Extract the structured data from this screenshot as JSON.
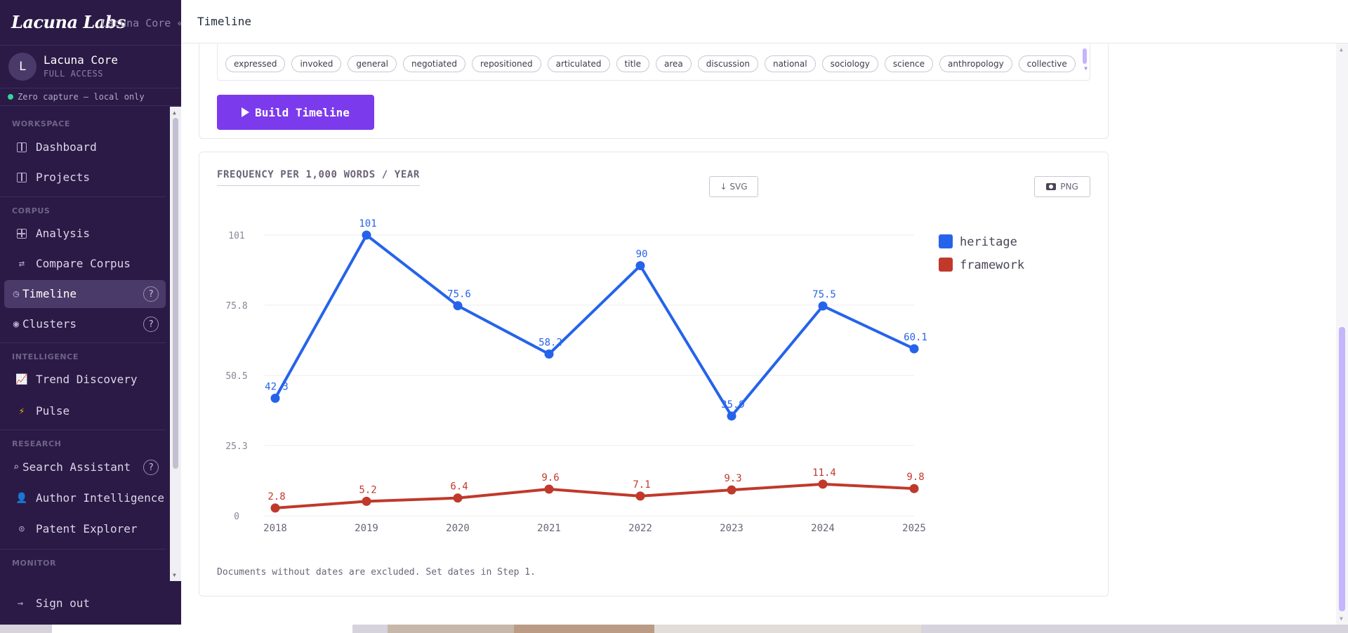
{
  "brand": {
    "logo": "Lacuna Labs",
    "subtitle": "Lacuna Core «"
  },
  "user": {
    "initial": "L",
    "name": "Lacuna Core",
    "role": "FULL ACCESS"
  },
  "privacy": {
    "text": "Zero capture — local only",
    "color": "#34d399"
  },
  "nav": {
    "sections": {
      "workspace": "WORKSPACE",
      "corpus": "CORPUS",
      "intelligence": "INTELLIGENCE",
      "research": "RESEARCH",
      "monitor": "MONITOR"
    },
    "items": [
      {
        "label": "Dashboard",
        "icon": "columns-icon"
      },
      {
        "label": "Projects",
        "icon": "columns-icon"
      },
      {
        "label": "Analysis",
        "icon": "grid-icon"
      },
      {
        "label": "Compare Corpus",
        "icon": "arrows-icon"
      },
      {
        "label": "Timeline",
        "icon": "clock-icon",
        "active": true,
        "help": "?"
      },
      {
        "label": "Clusters",
        "icon": "dot-icon",
        "help": "?"
      },
      {
        "label": "Trend Discovery",
        "icon": "chart-icon"
      },
      {
        "label": "Pulse",
        "icon": "bolt-icon"
      },
      {
        "label": "Search Assistant",
        "icon": "search-icon",
        "help": "?"
      },
      {
        "label": "Author Intelligence",
        "icon": "person-icon"
      },
      {
        "label": "Patent Explorer",
        "icon": "badge-icon"
      }
    ],
    "sign_out": "Sign out"
  },
  "header": {
    "title": "Timeline"
  },
  "terms": [
    "expressed",
    "invoked",
    "general",
    "negotiated",
    "repositioned",
    "articulated",
    "title",
    "area",
    "discussion",
    "national",
    "sociology",
    "science",
    "anthropology",
    "collective"
  ],
  "build_button": "Build Timeline",
  "chart_card": {
    "heading": "FREQUENCY PER 1,000 WORDS / YEAR",
    "export_svg": "↓ SVG",
    "export_png": "PNG",
    "note": "Documents without dates are excluded. Set dates in Step 1."
  },
  "accent": "#7c3aed",
  "chart_data": {
    "type": "line",
    "title": "FREQUENCY PER 1,000 WORDS / YEAR",
    "xlabel": "",
    "ylabel": "",
    "categories": [
      "2018",
      "2019",
      "2020",
      "2021",
      "2022",
      "2023",
      "2024",
      "2025"
    ],
    "y_ticks": [
      0,
      25.3,
      50.5,
      75.8,
      101
    ],
    "ylim": [
      0,
      101
    ],
    "grid": true,
    "legend": "right",
    "series": [
      {
        "name": "heritage",
        "color": "#2563eb",
        "values": [
          42.3,
          101,
          75.6,
          58.2,
          90,
          35.9,
          75.5,
          60.1
        ]
      },
      {
        "name": "framework",
        "color": "#c0392b",
        "values": [
          2.8,
          5.2,
          6.4,
          9.6,
          7.1,
          9.3,
          11.4,
          9.8
        ]
      }
    ]
  }
}
